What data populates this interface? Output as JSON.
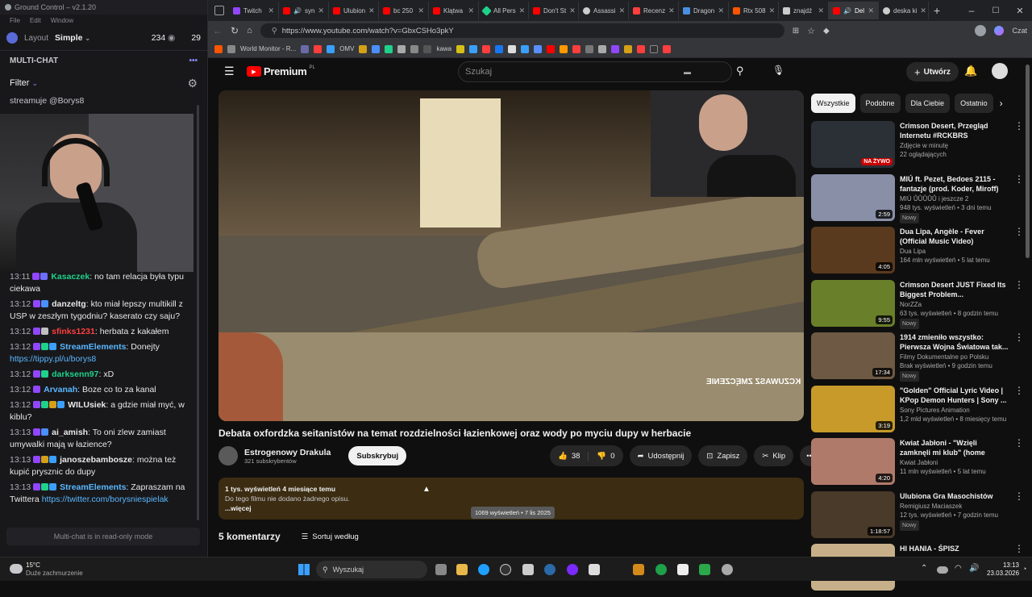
{
  "left_app": {
    "window_title": "Ground Control – v2.1.20",
    "menu": [
      "File",
      "Edit",
      "Window"
    ],
    "layout_label": "Layout",
    "layout_value": "Simple",
    "viewers": "234",
    "viewers2": "29",
    "section_title": "MULTI-CHAT",
    "filter_label": "Filter",
    "top_partial": "streamuje @Borys8",
    "messages": [
      {
        "time": "13:11",
        "user": "Kasaczek",
        "user_color": "#1fd18a",
        "text": "no tam relacja była typu ciekawa"
      },
      {
        "time": "13:12",
        "user": "danzeltg",
        "user_color": "#f1f1f1",
        "text": "kto miał lepszy multikill z USP w zeszłym tygodniu? kaserato czy saju?"
      },
      {
        "time": "13:12",
        "user": "sfinks1231",
        "user_color": "#ff3e3e",
        "text": "herbata z kakałem"
      },
      {
        "time": "13:12",
        "user": "StreamElements",
        "user_color": "#5ab8ff",
        "text": "Donejty",
        "link": "https://tippy.pl/u/borys8"
      },
      {
        "time": "13:12",
        "user": "darksenn97",
        "user_color": "#1fd18a",
        "text": "xD"
      },
      {
        "time": "13:12",
        "user": "Arvanah",
        "user_color": "#5ab8ff",
        "text": "Boze co to za kanal"
      },
      {
        "time": "13:12",
        "user": "WILUsiek",
        "user_color": "#f1f1f1",
        "text": "a gdzie miał myć, w kiblu?"
      },
      {
        "time": "13:13",
        "user": "ai_amish",
        "user_color": "#f1f1f1",
        "text": "To oni zlew zamiast umywalki mają w łazience?"
      },
      {
        "time": "13:13",
        "user": "janoszebambosze",
        "user_color": "#f1f1f1",
        "text": "można też kupić prysznic do dupy"
      },
      {
        "time": "13:13",
        "user": "StreamElements",
        "user_color": "#5ab8ff",
        "text": "Zapraszam na Twittera",
        "link": "https://twitter.com/borysniespielak"
      }
    ],
    "readonly_notice": "Multi-chat is in read-only mode"
  },
  "browser": {
    "tabs": [
      {
        "label": "Twitch",
        "color": "#9146ff"
      },
      {
        "label": "syn",
        "color": "#ff0000"
      },
      {
        "label": "Ulubion",
        "color": "#ff0000"
      },
      {
        "label": "bc 250",
        "color": "#ff0000"
      },
      {
        "label": "Klątwa",
        "color": "#ff0000"
      },
      {
        "label": "All Pers",
        "color": "#1fd18a"
      },
      {
        "label": "Don't St",
        "color": "#ff0000"
      },
      {
        "label": "Assassi",
        "color": "#cccccc"
      },
      {
        "label": "Recenz",
        "color": "#ff3e3e"
      },
      {
        "label": "Dragon",
        "color": "#4a90e2"
      },
      {
        "label": "Rtx 508",
        "color": "#ff5500"
      },
      {
        "label": "znajdź",
        "color": "#cccccc"
      },
      {
        "label": "Del",
        "color": "#ff0000"
      },
      {
        "label": "deska ki",
        "color": "#cccccc"
      }
    ],
    "url": "https://www.youtube.com/watch?v=GbxCSHo3pkY",
    "bookmark_labels": [
      "World Monitor - R...",
      "OMV",
      "kawa"
    ],
    "profile_label": "Czat"
  },
  "youtube": {
    "logo": "Premium",
    "logo_region": "PL",
    "search_placeholder": "Szukaj",
    "create_label": "Utwórz",
    "video_overlay_text": "KCZUWASZ ZMĘCZENIE",
    "title": "Debata oxfordzka seitanistów na temat rozdzielności łazienkowej oraz wody po myciu dupy w herbacie",
    "channel": "Estrogenowy Drakula",
    "subscribers": "321 subskrybentów",
    "subscribe": "Subskrybuj",
    "likes": "38",
    "dislikes": "0",
    "share": "Udostępnij",
    "save": "Zapisz",
    "clip": "Klip",
    "desc_stats": "1 tys. wyświetleń  4 miesiące temu",
    "desc_text": "Do tego filmu nie dodano żadnego opisu.",
    "desc_more": "...więcej",
    "tooltip": "1069 wyświetleń • 7 lis 2025",
    "comments_count": "5 komentarzy",
    "sort": "Sortuj według",
    "chips": [
      "Wszystkie",
      "Podobne",
      "Dla Ciebie",
      "Ostatnio"
    ],
    "recommended": [
      {
        "title": "Crimson Desert, Przegląd Internetu #RCKBRS",
        "channel": "Zdjęcie w minutę",
        "meta": "22 oglądających",
        "badge": "NA ŻYWO",
        "live": true,
        "thumb": "#2b2f36",
        "new": false
      },
      {
        "title": "MIÚ ft. Pezet, Bedoes 2115 - fantazje (prod. Koder, Miroff)",
        "channel": "MIÚ ŮŮŮŮŮ i jeszcze 2",
        "meta": "948 tys. wyświetleń • 3 dni temu",
        "badge": "2:59",
        "live": false,
        "thumb": "#8a8fa8",
        "new": true
      },
      {
        "title": "Dua Lipa, Angèle - Fever (Official Music Video)",
        "channel": "Dua Lipa",
        "meta": "164 mln wyświetleń • 5 lat temu",
        "badge": "4:05",
        "live": false,
        "thumb": "#5a3a1e",
        "new": false
      },
      {
        "title": "Crimson Desert JUST Fixed Its Biggest Problem...",
        "channel": "NorZZa",
        "meta": "63 tys. wyświetleń • 8 godzin temu",
        "badge": "9:55",
        "live": false,
        "thumb": "#6a7f2a",
        "new": true
      },
      {
        "title": "1914 zmieniło wszystko: Pierwsza Wojna Światowa tak...",
        "channel": "Filmy Dokumentalne po Polsku",
        "meta": "Brak wyświetleń • 9 godzin temu",
        "badge": "17:34",
        "live": false,
        "thumb": "#6e5a44",
        "new": true
      },
      {
        "title": "\"Golden\" Official Lyric Video | KPop Demon Hunters | Sony ...",
        "channel": "Sony Pictures Animation",
        "meta": "1,2 mld wyświetleń • 8 miesięcy temu",
        "badge": "3:19",
        "live": false,
        "thumb": "#c79a2a",
        "new": false
      },
      {
        "title": "Kwiat Jabłoni - \"Wzięli zamknęli mi klub\" (home edition)",
        "channel": "Kwiat Jabłoni",
        "meta": "11 mln wyświetleń • 5 lat temu",
        "badge": "4:20",
        "live": false,
        "thumb": "#b07a6a",
        "new": false
      },
      {
        "title": "Ulubiona Gra Masochistów",
        "channel": "Remigiusz Maciaszek",
        "meta": "12 tys. wyświetleń • 7 godzin temu",
        "badge": "1:18:57",
        "live": false,
        "thumb": "#4a3a2a",
        "new": true
      },
      {
        "title": "HI HANIA - ŚPISZ",
        "channel": "",
        "meta": "",
        "badge": "",
        "live": false,
        "thumb": "#c7b089",
        "new": false
      }
    ]
  },
  "taskbar": {
    "weather_temp": "15°C",
    "weather_desc": "Duże zachmurzenie",
    "search_placeholder": "Wyszukaj",
    "time": "13:13",
    "date": "23.03.2026"
  }
}
